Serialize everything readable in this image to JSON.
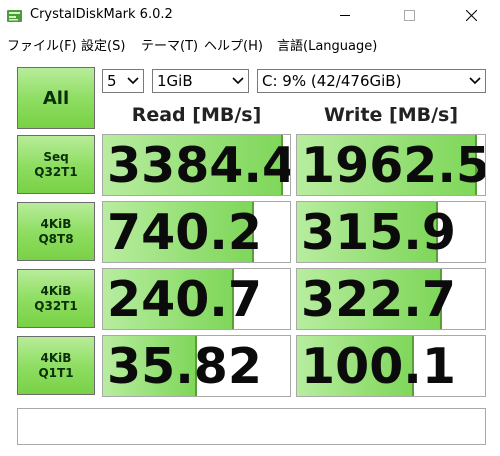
{
  "window": {
    "title": "CrystalDiskMark 6.0.2"
  },
  "menu": [
    {
      "label": "ファイル(F)"
    },
    {
      "label": "設定(S)"
    },
    {
      "label": "テーマ(T)"
    },
    {
      "label": "ヘルプ(H)"
    },
    {
      "label": "言語(Language)"
    }
  ],
  "controls": {
    "all_label": "All",
    "count": "5",
    "size": "1GiB",
    "drive": "C: 9% (42/476GiB)"
  },
  "headers": {
    "read": "Read [MB/s]",
    "write": "Write [MB/s]"
  },
  "tests": [
    {
      "line1": "Seq",
      "line2": "Q32T1",
      "read": "3384.4",
      "write": "1962.5",
      "read_fill": 0.96,
      "write_fill": 0.96
    },
    {
      "line1": "4KiB",
      "line2": "Q8T8",
      "read": "740.2",
      "write": "315.9",
      "read_fill": 0.81,
      "write_fill": 0.75
    },
    {
      "line1": "4KiB",
      "line2": "Q32T1",
      "read": "240.7",
      "write": "322.7",
      "read_fill": 0.7,
      "write_fill": 0.77
    },
    {
      "line1": "4KiB",
      "line2": "Q1T1",
      "read": "35.82",
      "write": "100.1",
      "read_fill": 0.5,
      "write_fill": 0.62
    }
  ],
  "status_text": "",
  "colors": {
    "button_green": "#8fde63",
    "bar_green": "#8fdd6e"
  }
}
